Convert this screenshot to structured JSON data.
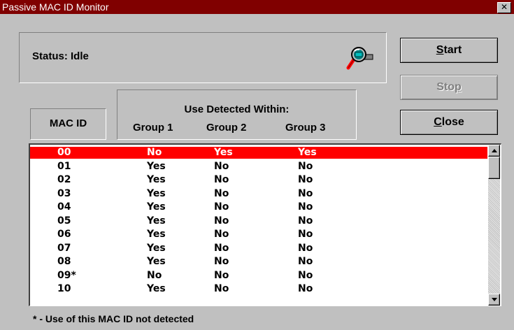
{
  "window": {
    "title": "Passive MAC ID Monitor",
    "close_glyph": "✕"
  },
  "status": {
    "text": "Status: Idle",
    "icon": "magnifier-icon"
  },
  "buttons": {
    "start": {
      "pre": "",
      "u": "S",
      "post": "tart",
      "enabled": true
    },
    "stop": {
      "pre": "Sto",
      "u": "p",
      "post": "",
      "enabled": false
    },
    "close": {
      "pre": "",
      "u": "C",
      "post": "lose",
      "enabled": true
    }
  },
  "table_header": {
    "mac_id": "MAC ID",
    "group_title": "Use Detected Within:",
    "groups": [
      "Group 1",
      "Group 2",
      "Group 3"
    ]
  },
  "rows": [
    {
      "mac": "00",
      "g1": "No",
      "g2": "Yes",
      "g3": "Yes",
      "selected": true
    },
    {
      "mac": "01",
      "g1": "Yes",
      "g2": "No",
      "g3": "No"
    },
    {
      "mac": "02",
      "g1": "Yes",
      "g2": "No",
      "g3": "No"
    },
    {
      "mac": "03",
      "g1": "Yes",
      "g2": "No",
      "g3": "No"
    },
    {
      "mac": "04",
      "g1": "Yes",
      "g2": "No",
      "g3": "No"
    },
    {
      "mac": "05",
      "g1": "Yes",
      "g2": "No",
      "g3": "No"
    },
    {
      "mac": "06",
      "g1": "Yes",
      "g2": "No",
      "g3": "No"
    },
    {
      "mac": "07",
      "g1": "Yes",
      "g2": "No",
      "g3": "No"
    },
    {
      "mac": "08",
      "g1": "Yes",
      "g2": "No",
      "g3": "No"
    },
    {
      "mac": "09*",
      "g1": "No",
      "g2": "No",
      "g3": "No"
    },
    {
      "mac": "10",
      "g1": "Yes",
      "g2": "No",
      "g3": "No"
    }
  ],
  "colors": {
    "titlebar": "#800000",
    "selection": "#ff0000",
    "face": "#c0c0c0"
  },
  "footnote": "* - Use of this MAC ID not detected"
}
